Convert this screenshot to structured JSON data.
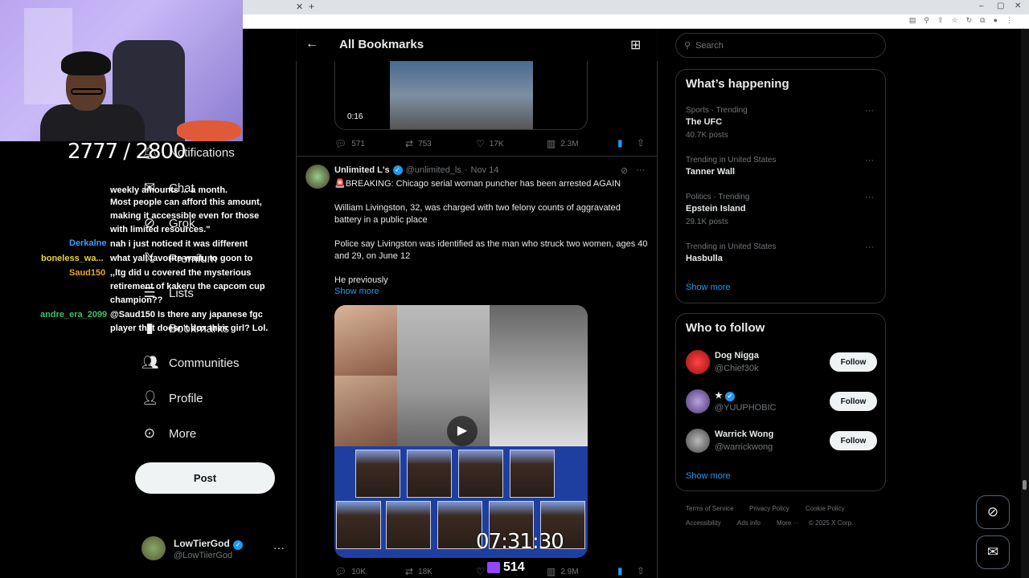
{
  "header": {
    "title": "All Bookmarks"
  },
  "overlay": {
    "sub_count": "2777 / 2800",
    "timer": "07:31:30",
    "viewers": "514",
    "chat": [
      {
        "name": "",
        "text": "weekly amounts ... a month."
      },
      {
        "name": "",
        "text": "Most people can afford this amount,"
      },
      {
        "name": "",
        "text": "making it accessible even for those"
      },
      {
        "name": "",
        "text": "with limited resources.\""
      },
      {
        "name": "Derkalne",
        "text": "nah i just noticed it was different"
      },
      {
        "name": "boneless_wa...",
        "text": "what yall favorite waifu to goon to"
      },
      {
        "name": "Saud150",
        "text": ",,ltg did u covered the mysterious"
      },
      {
        "name": "",
        "text": "retirement of kakeru the capcom cup"
      },
      {
        "name": "",
        "text": "champion??"
      },
      {
        "name": "andre_era_2099",
        "text": "@Saud150 Is there any japanese fgc"
      },
      {
        "name": "",
        "text": "player that doesn't dox their girl? Lol."
      }
    ]
  },
  "nav": {
    "items": [
      {
        "label": "Notifications",
        "icon": "bell-icon"
      },
      {
        "label": "Chat",
        "icon": "mail-icon"
      },
      {
        "label": "Grok",
        "icon": "grok-icon"
      },
      {
        "label": "Premium",
        "icon": "x-icon"
      },
      {
        "label": "Lists",
        "icon": "list-icon"
      },
      {
        "label": "Bookmarks",
        "icon": "bookmark-icon"
      },
      {
        "label": "Communities",
        "icon": "people-icon"
      },
      {
        "label": "Profile",
        "icon": "person-icon"
      },
      {
        "label": "More",
        "icon": "more-circle-icon"
      }
    ],
    "post_label": "Post",
    "account": {
      "name": "LowTierGod",
      "handle": "@LowTiierGod"
    }
  },
  "tweet_prev": {
    "duration": "0:16",
    "replies": "571",
    "retweets": "753",
    "likes": "17K",
    "views": "2.3M"
  },
  "tweet": {
    "name": "Unlimited L's",
    "handle": "@unlimited_ls",
    "date": "Nov 14",
    "lines": [
      "🚨BREAKING: Chicago serial woman puncher has been arrested AGAIN",
      "William Livingston, 32, was charged with two felony counts of aggravated battery in a public place",
      "Police say Livingston was identified as the man who struck two women, ages 40 and 29, on June 12",
      "He previously"
    ],
    "show_more": "Show more",
    "replies": "10K",
    "retweets": "18K",
    "likes": "",
    "views": "2.9M"
  },
  "search": {
    "placeholder": "Search"
  },
  "happening": {
    "title": "What’s happening",
    "trends": [
      {
        "meta": "Sports · Trending",
        "name": "The UFC",
        "count": "40.7K posts"
      },
      {
        "meta": "Trending in United States",
        "name": "Tanner Wall",
        "count": ""
      },
      {
        "meta": "Politics · Trending",
        "name": "Epstein Island",
        "count": "29.1K posts"
      },
      {
        "meta": "Trending in United States",
        "name": "Hasbulla",
        "count": ""
      }
    ],
    "show_more": "Show more"
  },
  "who_to_follow": {
    "title": "Who to follow",
    "users": [
      {
        "name": "Dog Nigga",
        "handle": "@Chief30k",
        "button": "Follow"
      },
      {
        "name": "★",
        "handle": "@YUUPHOBIC",
        "button": "Follow"
      },
      {
        "name": "Warrick Wong",
        "handle": "@warrickwong",
        "button": "Follow"
      }
    ],
    "show_more": "Show more"
  },
  "footer": {
    "links": [
      "Terms of Service",
      "Privacy Policy",
      "Cookie Policy",
      "Accessibility",
      "Ads info",
      "More ···",
      "© 2025 X Corp."
    ]
  },
  "colors": {
    "accent": "#1d9bf0",
    "background": "#000000",
    "border": "#2f3336",
    "muted": "#71767b"
  }
}
